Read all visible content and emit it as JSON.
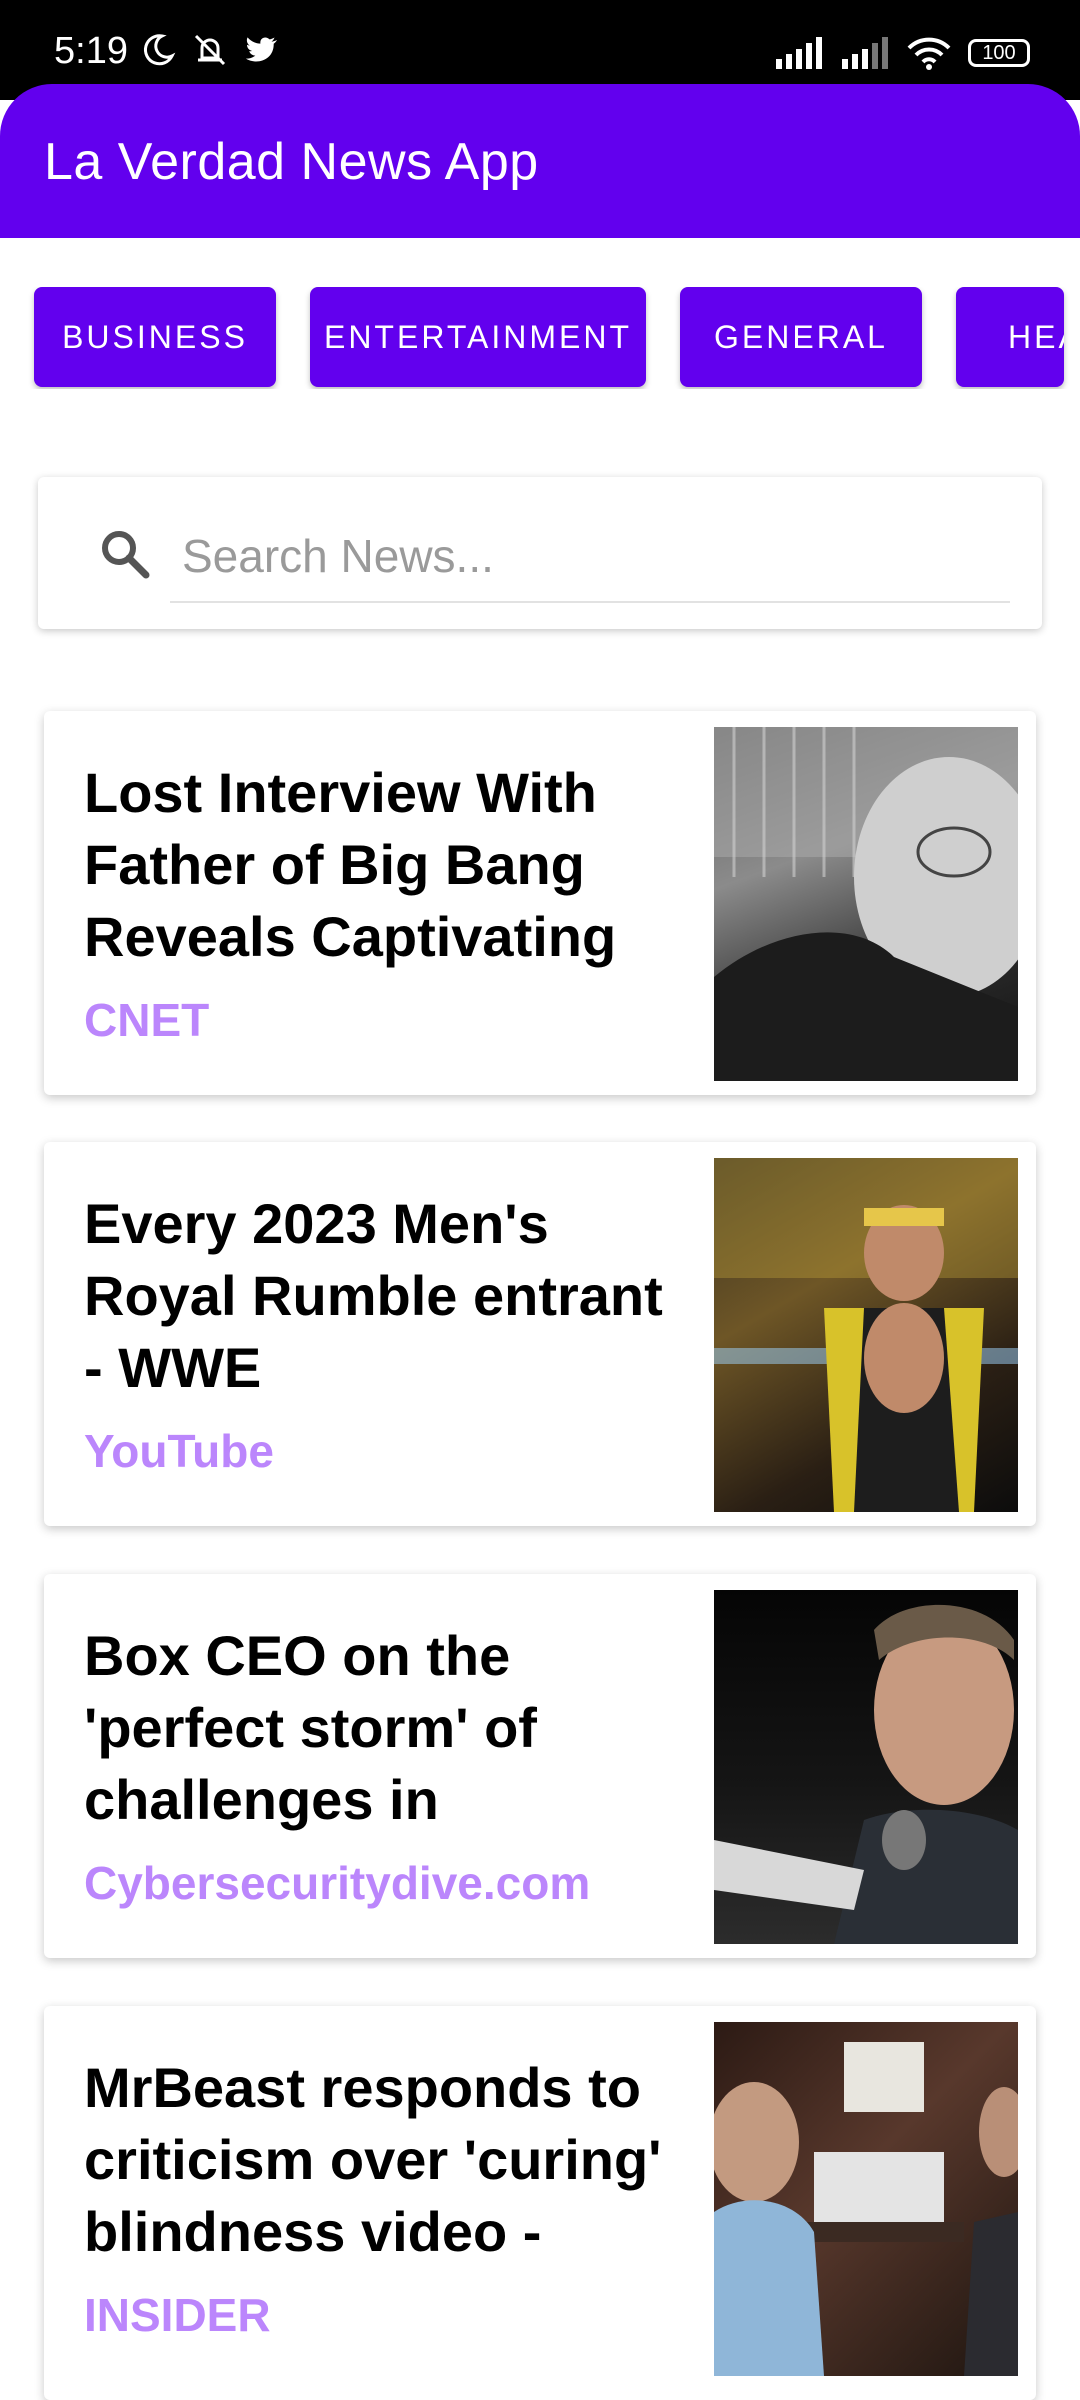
{
  "status_bar": {
    "time": "5:19",
    "left_icons": [
      "moon-icon",
      "muted-bell-icon",
      "twitter-icon"
    ],
    "right_icons": [
      "signal-icon",
      "signal-icon",
      "wifi-icon"
    ],
    "battery": "100"
  },
  "app_bar": {
    "title": "La Verdad News App",
    "color": "#6200ee"
  },
  "categories": [
    {
      "label": "BUSINESS"
    },
    {
      "label": "ENTERTAINMENT"
    },
    {
      "label": "GENERAL"
    },
    {
      "label": "HEA"
    }
  ],
  "search": {
    "placeholder": "Search News...",
    "value": ""
  },
  "news": [
    {
      "title": "Lost Interview With Father of Big Bang Reveals Captivating",
      "source": "CNET"
    },
    {
      "title": "Every 2023 Men's Royal Rumble entrant - WWE",
      "source": "YouTube"
    },
    {
      "title": "Box CEO on the 'perfect storm' of challenges in",
      "source": "Cybersecuritydive.com"
    },
    {
      "title": "MrBeast responds to criticism over 'curing' blindness video -",
      "source": "INSIDER"
    }
  ],
  "colors": {
    "accent": "#6200ee",
    "source_text": "#bb86fc"
  }
}
